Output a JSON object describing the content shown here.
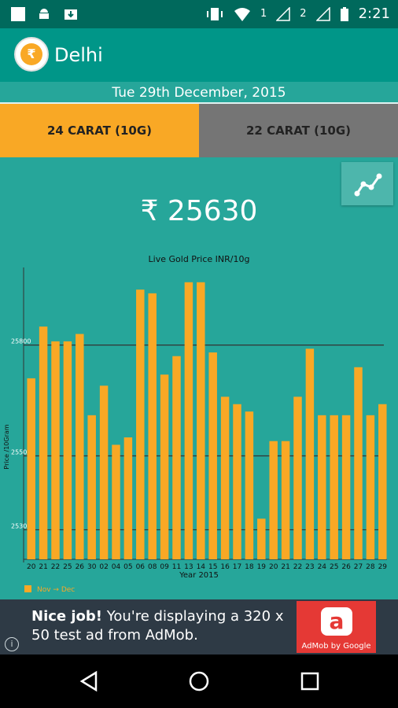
{
  "status": {
    "time": "2:21",
    "sim1": "1",
    "sim2": "2"
  },
  "app": {
    "title": "Delhi",
    "logo_symbol": "₹"
  },
  "date": "Tue 29th December, 2015",
  "tabs": [
    {
      "label": "24 CARAT (10G)",
      "color": "#f9a825"
    },
    {
      "label": "22 CARAT (10G)",
      "color": "#757575"
    }
  ],
  "price": "₹ 25630",
  "icons": {
    "trend": "trend-chart-icon"
  },
  "chart_data": {
    "type": "bar",
    "title": "Live Gold Price INR/10g",
    "xlabel": "Year 2015",
    "ylabel": "Price /10Gram",
    "categories": [
      "20",
      "21",
      "22",
      "25",
      "26",
      "30",
      "02",
      "04",
      "05",
      "06",
      "08",
      "09",
      "11",
      "13",
      "14",
      "15",
      "16",
      "17",
      "18",
      "19",
      "20",
      "21",
      "22",
      "23",
      "24",
      "25",
      "26",
      "27",
      "28",
      "29"
    ],
    "series": [
      {
        "name": "Nov → Dec",
        "values": [
          25710,
          25850,
          25810,
          25810,
          25830,
          25610,
          25690,
          25530,
          25550,
          25950,
          25940,
          25720,
          25770,
          25970,
          25970,
          25780,
          25660,
          25640,
          25620,
          25330,
          25540,
          25540,
          25660,
          25790,
          25610,
          25610,
          25610,
          25740,
          25610,
          25640
        ]
      }
    ],
    "ylim": [
      25220,
      26010
    ],
    "gridlines": [
      25800,
      25500,
      25300
    ],
    "yticks": [
      "25800",
      "25500",
      "25300"
    ],
    "bar_color": "#f9a825",
    "legend": "bottom-left"
  },
  "admob": {
    "headline": "Nice job!",
    "body": " You're displaying a 320 x 50 test ad from AdMob.",
    "logo_caption": "AdMob by Google",
    "info": "i"
  }
}
